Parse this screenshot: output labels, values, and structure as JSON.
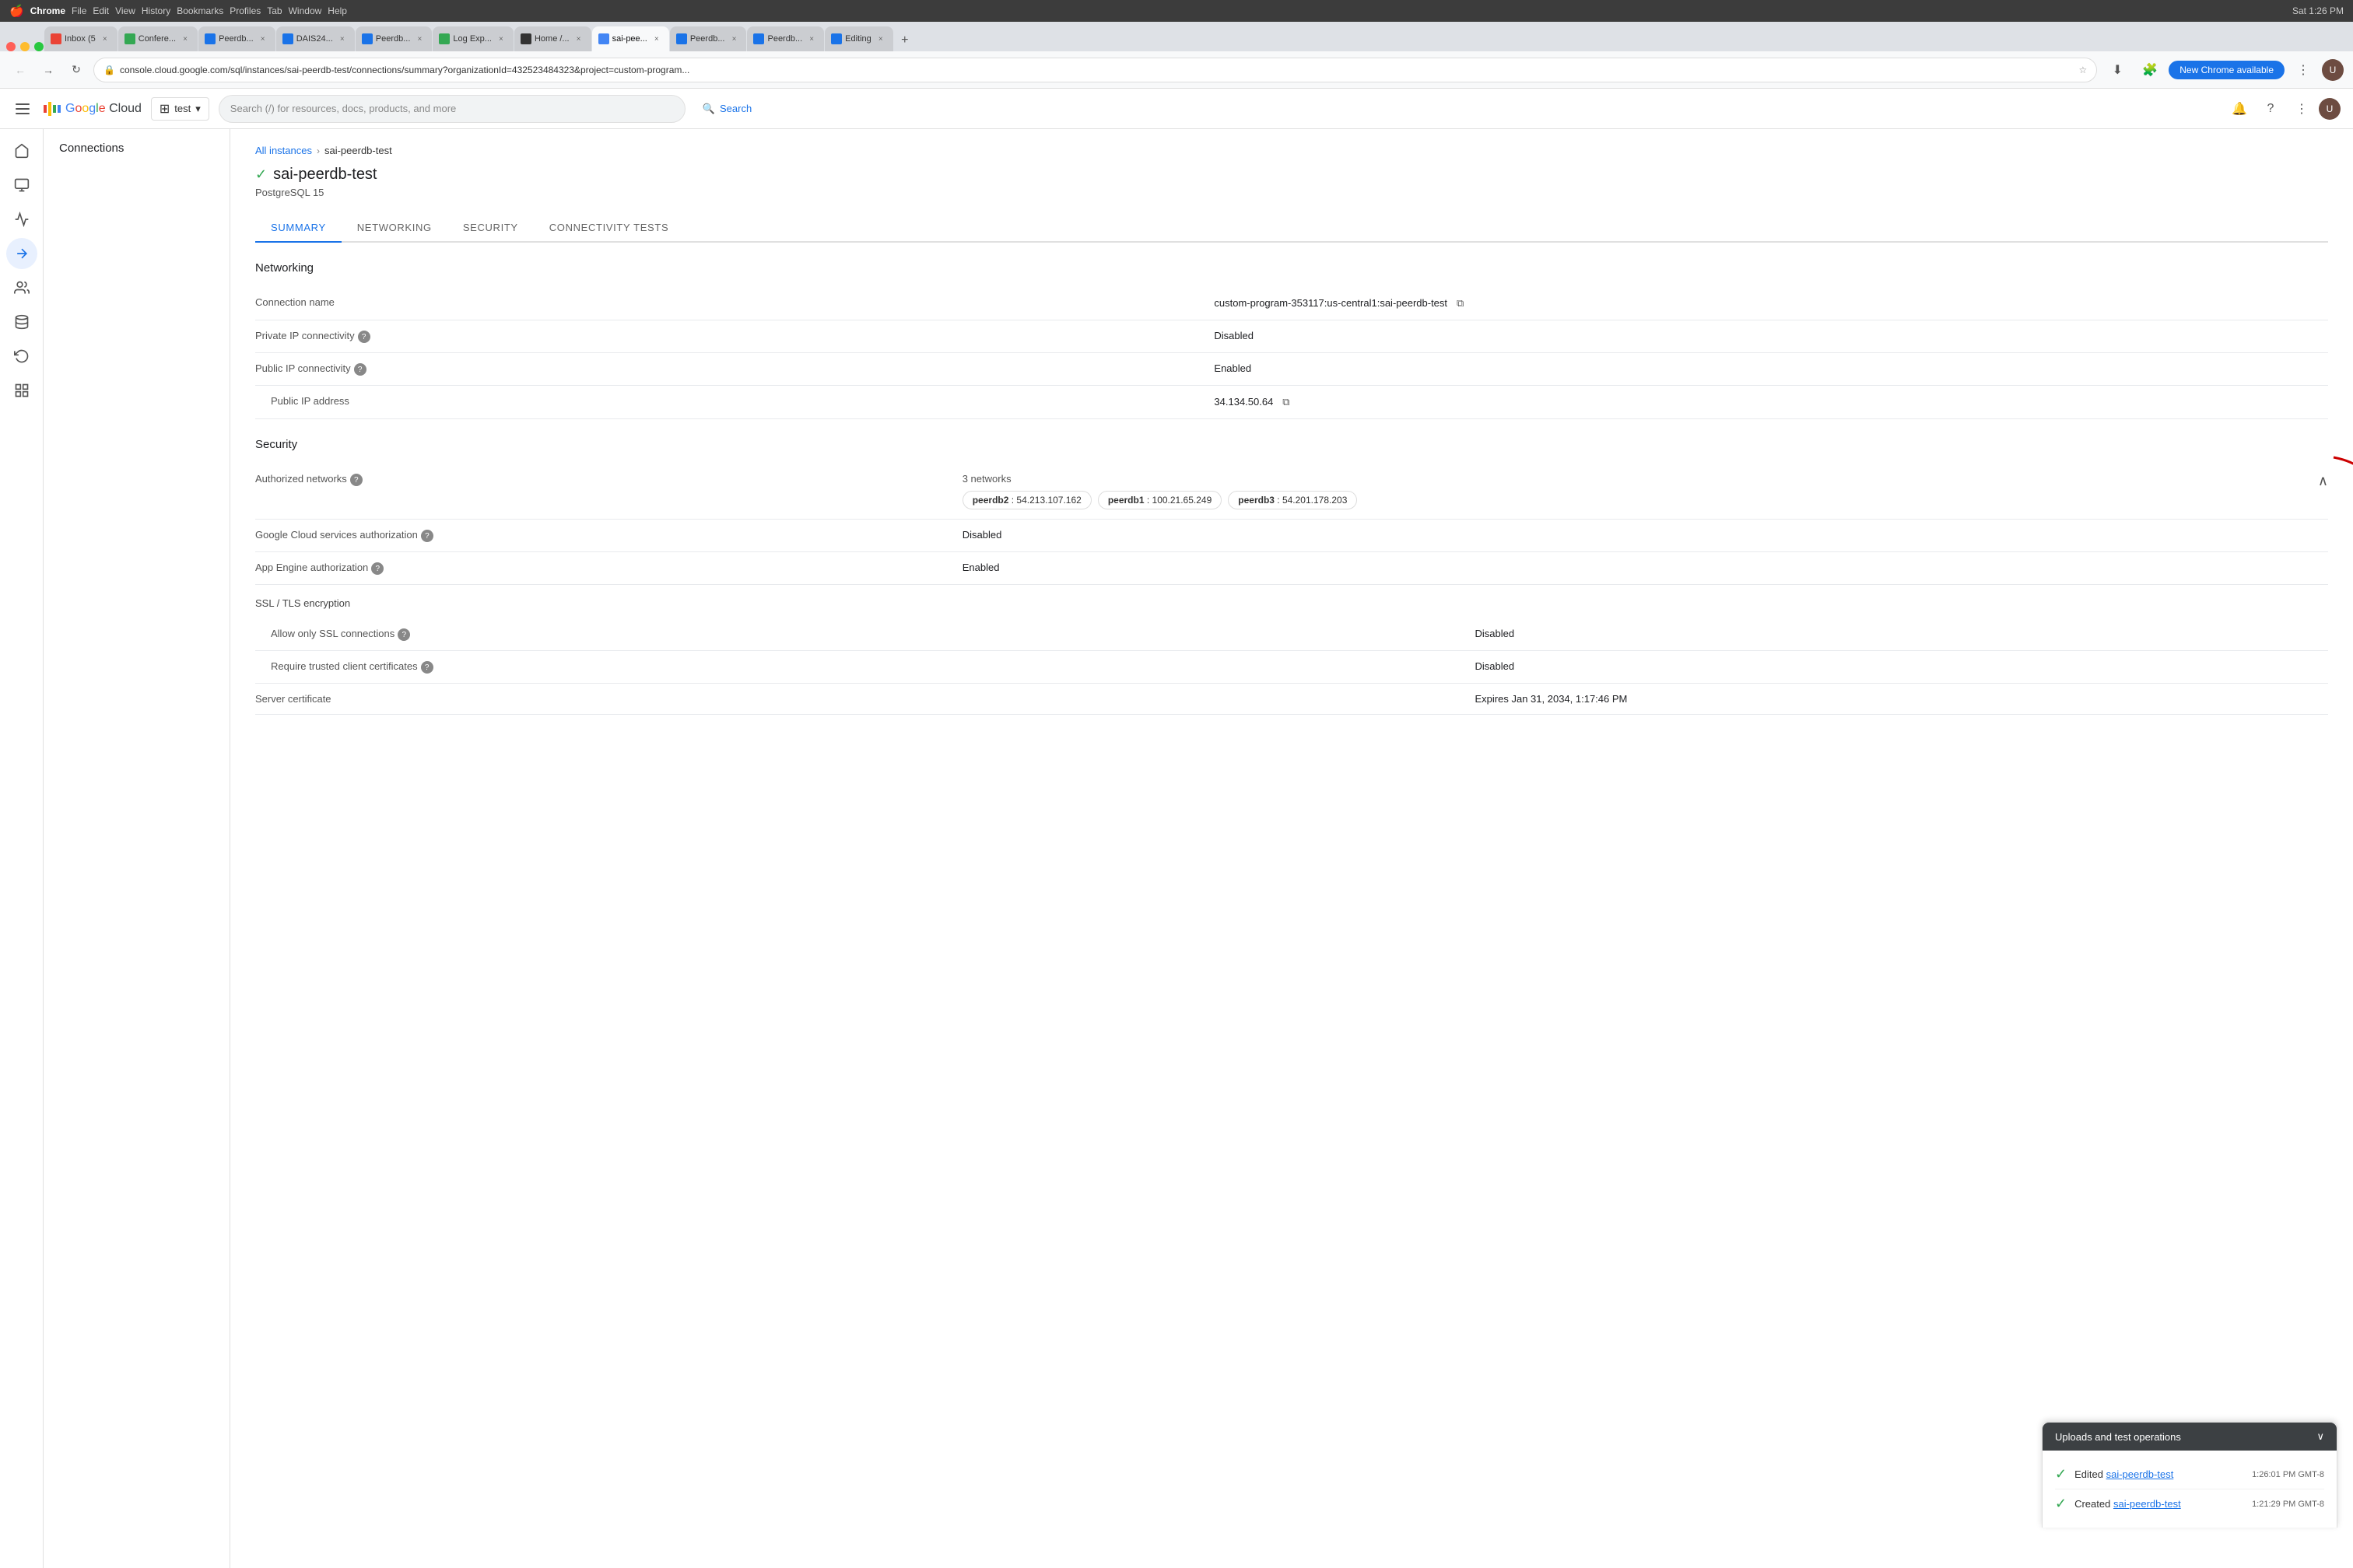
{
  "os": {
    "time": "Sat 1:26 PM",
    "app_name": "Chrome"
  },
  "chrome": {
    "menus": [
      "Chrome",
      "File",
      "Edit",
      "View",
      "History",
      "Bookmarks",
      "Profiles",
      "Tab",
      "Window",
      "Help"
    ],
    "tabs": [
      {
        "id": 1,
        "title": "Inbox (5",
        "color": "#ea4335",
        "active": false
      },
      {
        "id": 2,
        "title": "Confere...",
        "color": "#34a853",
        "active": false
      },
      {
        "id": 3,
        "title": "Peerdb...",
        "color": "#1a73e8",
        "active": false
      },
      {
        "id": 4,
        "title": "DAIS24...",
        "color": "#1a73e8",
        "active": false
      },
      {
        "id": 5,
        "title": "Peerdb...",
        "color": "#1a73e8",
        "active": false
      },
      {
        "id": 6,
        "title": "Log Exp...",
        "color": "#34a853",
        "active": false
      },
      {
        "id": 7,
        "title": "Home /...",
        "color": "#1a1a1a",
        "active": false
      },
      {
        "id": 8,
        "title": "sai-pee...",
        "color": "#4285f4",
        "active": true
      },
      {
        "id": 9,
        "title": "Peerdb...",
        "color": "#1a73e8",
        "active": false
      },
      {
        "id": 10,
        "title": "Peerdb...",
        "color": "#1a73e8",
        "active": false
      },
      {
        "id": 11,
        "title": "Editing",
        "color": "#1a73e8",
        "active": false
      }
    ],
    "address": "console.cloud.google.com/sql/instances/sai-peerdb-test/connections/summary?organizationId=432523484323&project=custom-program...",
    "new_chrome_label": "New Chrome available"
  },
  "gcp": {
    "logo": "Google Cloud",
    "project": "test",
    "search_placeholder": "Search (/) for resources, docs, products, and more",
    "search_btn": "Search",
    "sidebar_items": [
      {
        "icon": "≡",
        "label": ""
      },
      {
        "icon": "⊞",
        "label": ""
      },
      {
        "icon": "◫",
        "label": ""
      },
      {
        "icon": "📊",
        "label": ""
      },
      {
        "icon": "→",
        "label": ""
      },
      {
        "icon": "👥",
        "label": ""
      },
      {
        "icon": "▦",
        "label": ""
      },
      {
        "icon": "⧉",
        "label": ""
      },
      {
        "icon": "⊟",
        "label": ""
      },
      {
        "icon": "☰",
        "label": ""
      }
    ],
    "left_nav_title": "Connections",
    "breadcrumb": {
      "parent": "All instances",
      "current": "sai-peerdb-test"
    },
    "instance": {
      "name": "sai-peerdb-test",
      "version": "PostgreSQL 15",
      "status": "running"
    },
    "tabs": [
      "SUMMARY",
      "NETWORKING",
      "SECURITY",
      "CONNECTIVITY TESTS"
    ],
    "active_tab": "SUMMARY",
    "networking": {
      "title": "Networking",
      "fields": [
        {
          "label": "Connection name",
          "value": "custom-program-353117:us-central1:sai-peerdb-test",
          "copy": true,
          "help": false
        },
        {
          "label": "Private IP connectivity",
          "value": "Disabled",
          "copy": false,
          "help": true
        },
        {
          "label": "Public IP connectivity",
          "value": "Enabled",
          "copy": false,
          "help": true
        },
        {
          "label": "Public IP address",
          "value": "34.134.50.64",
          "copy": true,
          "help": false,
          "indent": true
        }
      ]
    },
    "security": {
      "title": "Security",
      "networks_count": "3 networks",
      "networks": [
        {
          "name": "peerdb2",
          "ip": "54.213.107.162"
        },
        {
          "name": "peerdb1",
          "ip": "100.21.65.249"
        },
        {
          "name": "peerdb3",
          "ip": "54.201.178.203"
        }
      ],
      "fields": [
        {
          "label": "Google Cloud services authorization",
          "value": "Disabled",
          "help": true
        },
        {
          "label": "App Engine authorization",
          "value": "Enabled",
          "help": true
        }
      ],
      "ssl_title": "SSL / TLS encryption",
      "ssl_fields": [
        {
          "label": "Allow only SSL connections",
          "value": "Disabled",
          "help": true,
          "indent": true
        },
        {
          "label": "Require trusted client certificates",
          "value": "Disabled",
          "help": true,
          "indent": true
        },
        {
          "label": "Server certificate",
          "value": "Expires Jan 31, 2034, 1:17:46 PM",
          "help": false,
          "indent": false
        }
      ]
    },
    "bottom_panel": {
      "title": "Uploads and test operations",
      "items": [
        {
          "status": "success",
          "text": "Edited",
          "link": "sai-peerdb-test",
          "time": "1:26:01 PM GMT-8"
        },
        {
          "status": "success",
          "text": "Created",
          "link": "sai-peerdb-test",
          "time": "1:21:29 PM GMT-8"
        }
      ]
    }
  }
}
